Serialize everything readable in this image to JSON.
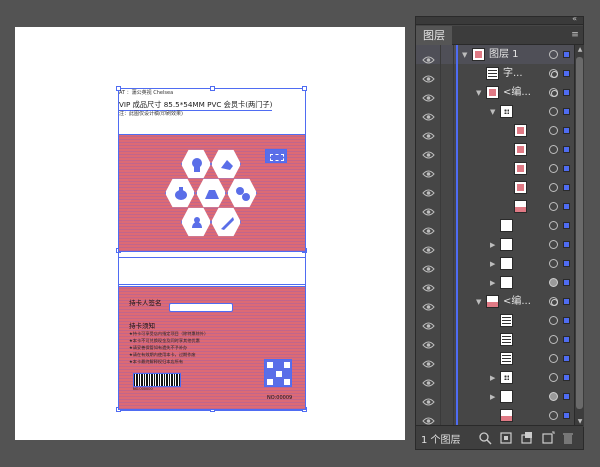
{
  "panel": {
    "tab_label": "图层",
    "chrome_glyph": "«",
    "close_glyph": "×",
    "menu_glyph": "▾≡",
    "footer": {
      "layer_count": "1 个图层"
    },
    "accent_color": "#4f6cf2"
  },
  "layers": [
    {
      "label": "图层 1",
      "expanded": true,
      "selected": true
    },
    {
      "label": "字..."
    },
    {
      "label": "<编..."
    },
    {
      "label": ""
    },
    {
      "label": ""
    },
    {
      "label": ""
    },
    {
      "label": ""
    },
    {
      "label": ""
    },
    {
      "label": ""
    },
    {
      "label": ""
    },
    {
      "label": ""
    },
    {
      "label": ""
    },
    {
      "label": ""
    },
    {
      "label": "<编..."
    },
    {
      "label": ""
    },
    {
      "label": ""
    },
    {
      "label": ""
    },
    {
      "label": ""
    },
    {
      "label": ""
    },
    {
      "label": ""
    }
  ],
  "card": {
    "info_top": "AT ：蒲公英视 Chelsea",
    "info_title": "VIP 成品尺寸 85.5*54MM PVC 会员卡(两门子)",
    "info_sub": "注：此图仅设计稿(印刷效果)",
    "holder_label": "持卡人签名",
    "notice_title": "持卡须知",
    "notice_lines": [
      "★持卡可享受店内指定项目（除特惠除外）",
      "★本卡不可兑换现金及同时享其他优惠",
      "★请妥善保管如有遗失不予补办",
      "★请在有效期内使用本卡，过期作废",
      "★本卡最终解释权归本店所有"
    ],
    "barcode_number": "NO.000000",
    "card_no": "NO:00009"
  }
}
